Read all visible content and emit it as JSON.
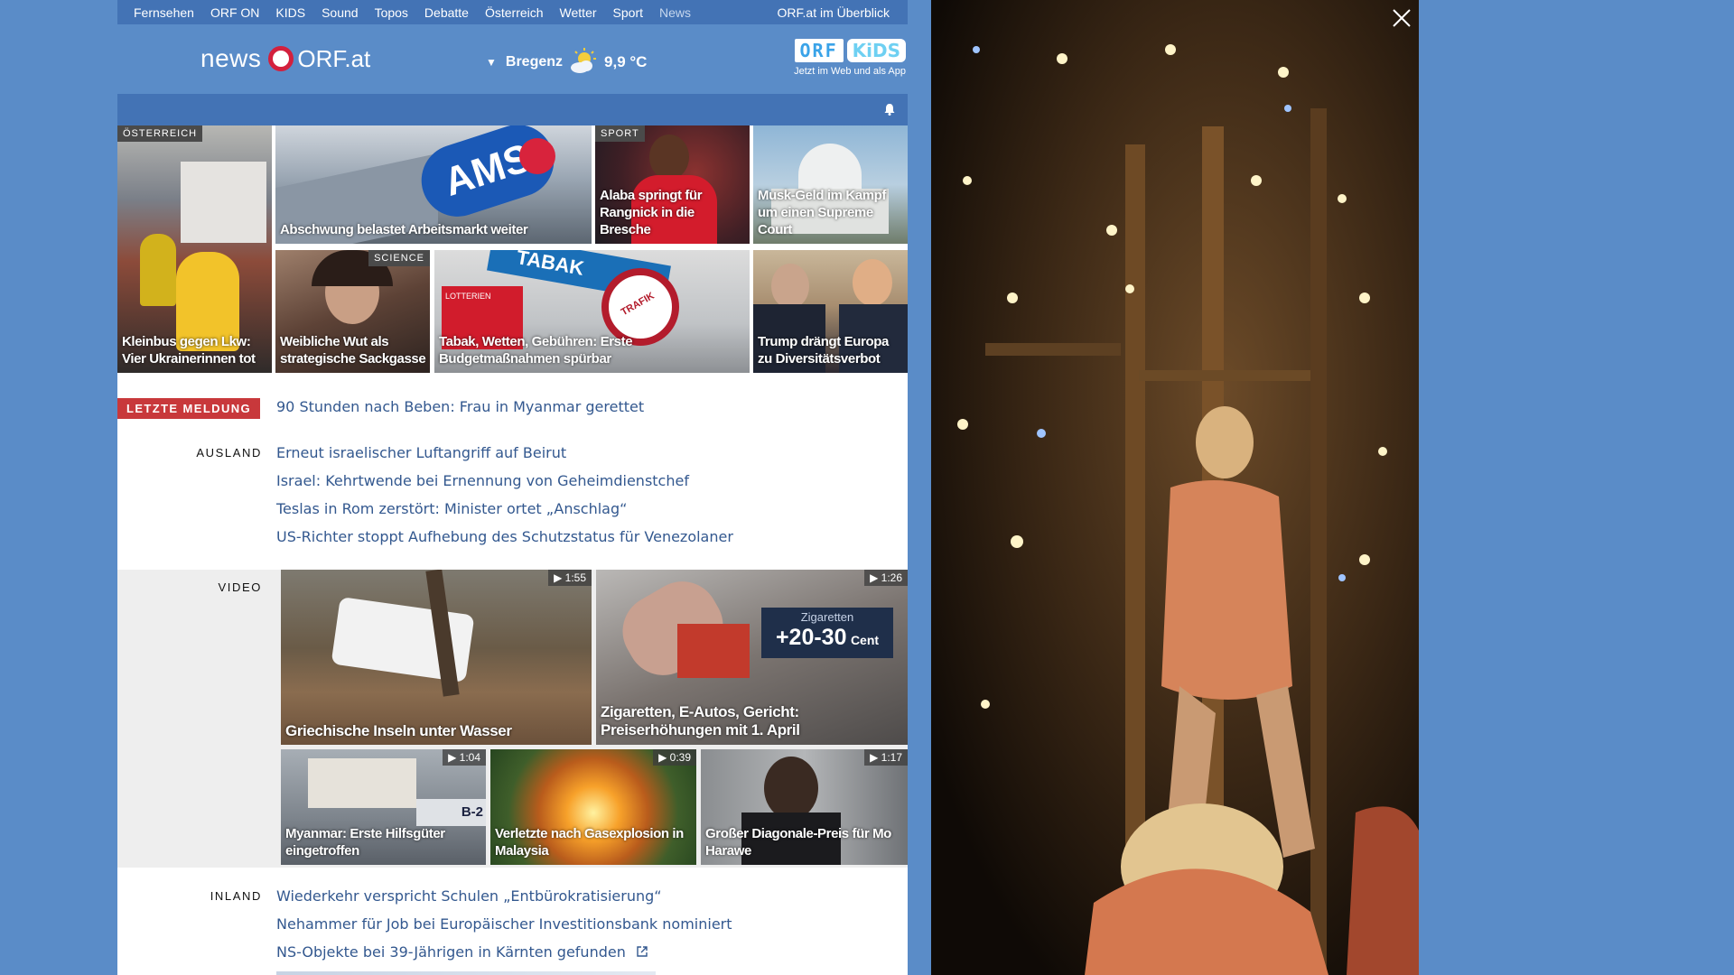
{
  "nav": {
    "items": [
      "Fernsehen",
      "ORF ON",
      "KIDS",
      "Sound",
      "Topos",
      "Debatte",
      "Österreich",
      "Wetter",
      "Sport",
      "News"
    ],
    "overview": "ORF.at im Überblick"
  },
  "logo": {
    "news": "news",
    "orfat": "ORF.at"
  },
  "weather": {
    "city": "Bregenz",
    "temp": "9,9 °C",
    "icon": "partly-sunny-icon"
  },
  "kids": {
    "part1": "ORF",
    "part2": "KiDS",
    "tagline": "Jetzt im Web und als App"
  },
  "teasers": [
    {
      "kicker": "ÖSTERREICH",
      "title": "Kleinbus gegen Lkw: Vier Ukrainerinnen tot"
    },
    {
      "kicker": "",
      "title": "Abschwung belastet Arbeitsmarkt weiter"
    },
    {
      "kicker": "SPORT",
      "title": "Alaba springt für Rangnick in die Bresche"
    },
    {
      "kicker": "",
      "title": "Musk-Geld im Kampf um einen Supreme Court"
    },
    {
      "kicker": "SCIENCE",
      "title": "Weibliche Wut als strategische Sackgasse"
    },
    {
      "kicker": "",
      "title": "Tabak, Wetten, Gebühren: Erste Budgetmaßnahmen spürbar"
    },
    {
      "kicker": "",
      "title": "Trump drängt Europa zu Diversitätsverbot"
    }
  ],
  "breaking": {
    "label": "LETZTE MELDUNG",
    "text": "90 Stunden nach Beben: Frau in Myanmar gerettet"
  },
  "ausland": {
    "label": "AUSLAND",
    "links": [
      "Erneut israelischer Luftangriff auf Beirut",
      "Israel: Kehrtwende bei Ernennung von Geheimdienstchef",
      "Teslas in Rom zerstört: Minister ortet „Anschlag“",
      "US-Richter stoppt Aufhebung des Schutzstatus für Venezolaner"
    ]
  },
  "video": {
    "label": "VIDEO",
    "items": [
      {
        "duration": "1:55",
        "title": "Griechische Inseln unter Wasser"
      },
      {
        "duration": "1:26",
        "title": "Zigaretten, E-Autos, Gericht: Preiserhöhungen mit 1. April",
        "badge_top": "Zigaretten",
        "badge_main": "+20-30",
        "badge_unit": "Cent"
      },
      {
        "duration": "1:04",
        "title": "Myanmar: Erste Hilfsgüter eingetroffen",
        "plane_code": "B-2"
      },
      {
        "duration": "0:39",
        "title": "Verletzte nach Gasexplosion in Malaysia"
      },
      {
        "duration": "1:17",
        "title": "Großer Diagonale-Preis für Mo Harawe"
      }
    ]
  },
  "inland": {
    "label": "INLAND",
    "links": [
      "Wiederkehr verspricht Schulen „Entbürokratisierung“",
      "Nehammer für Job bei Europäischer Investitionsbank nominiert",
      "NS-Objekte bei 39-Jährigen in Kärnten gefunden"
    ]
  },
  "sample_images": {
    "ams_sign": "AMS",
    "tabak_sign": "TABAK",
    "trafik_sign": "TRAFIK",
    "lotterien": "LOTTERIEN"
  }
}
